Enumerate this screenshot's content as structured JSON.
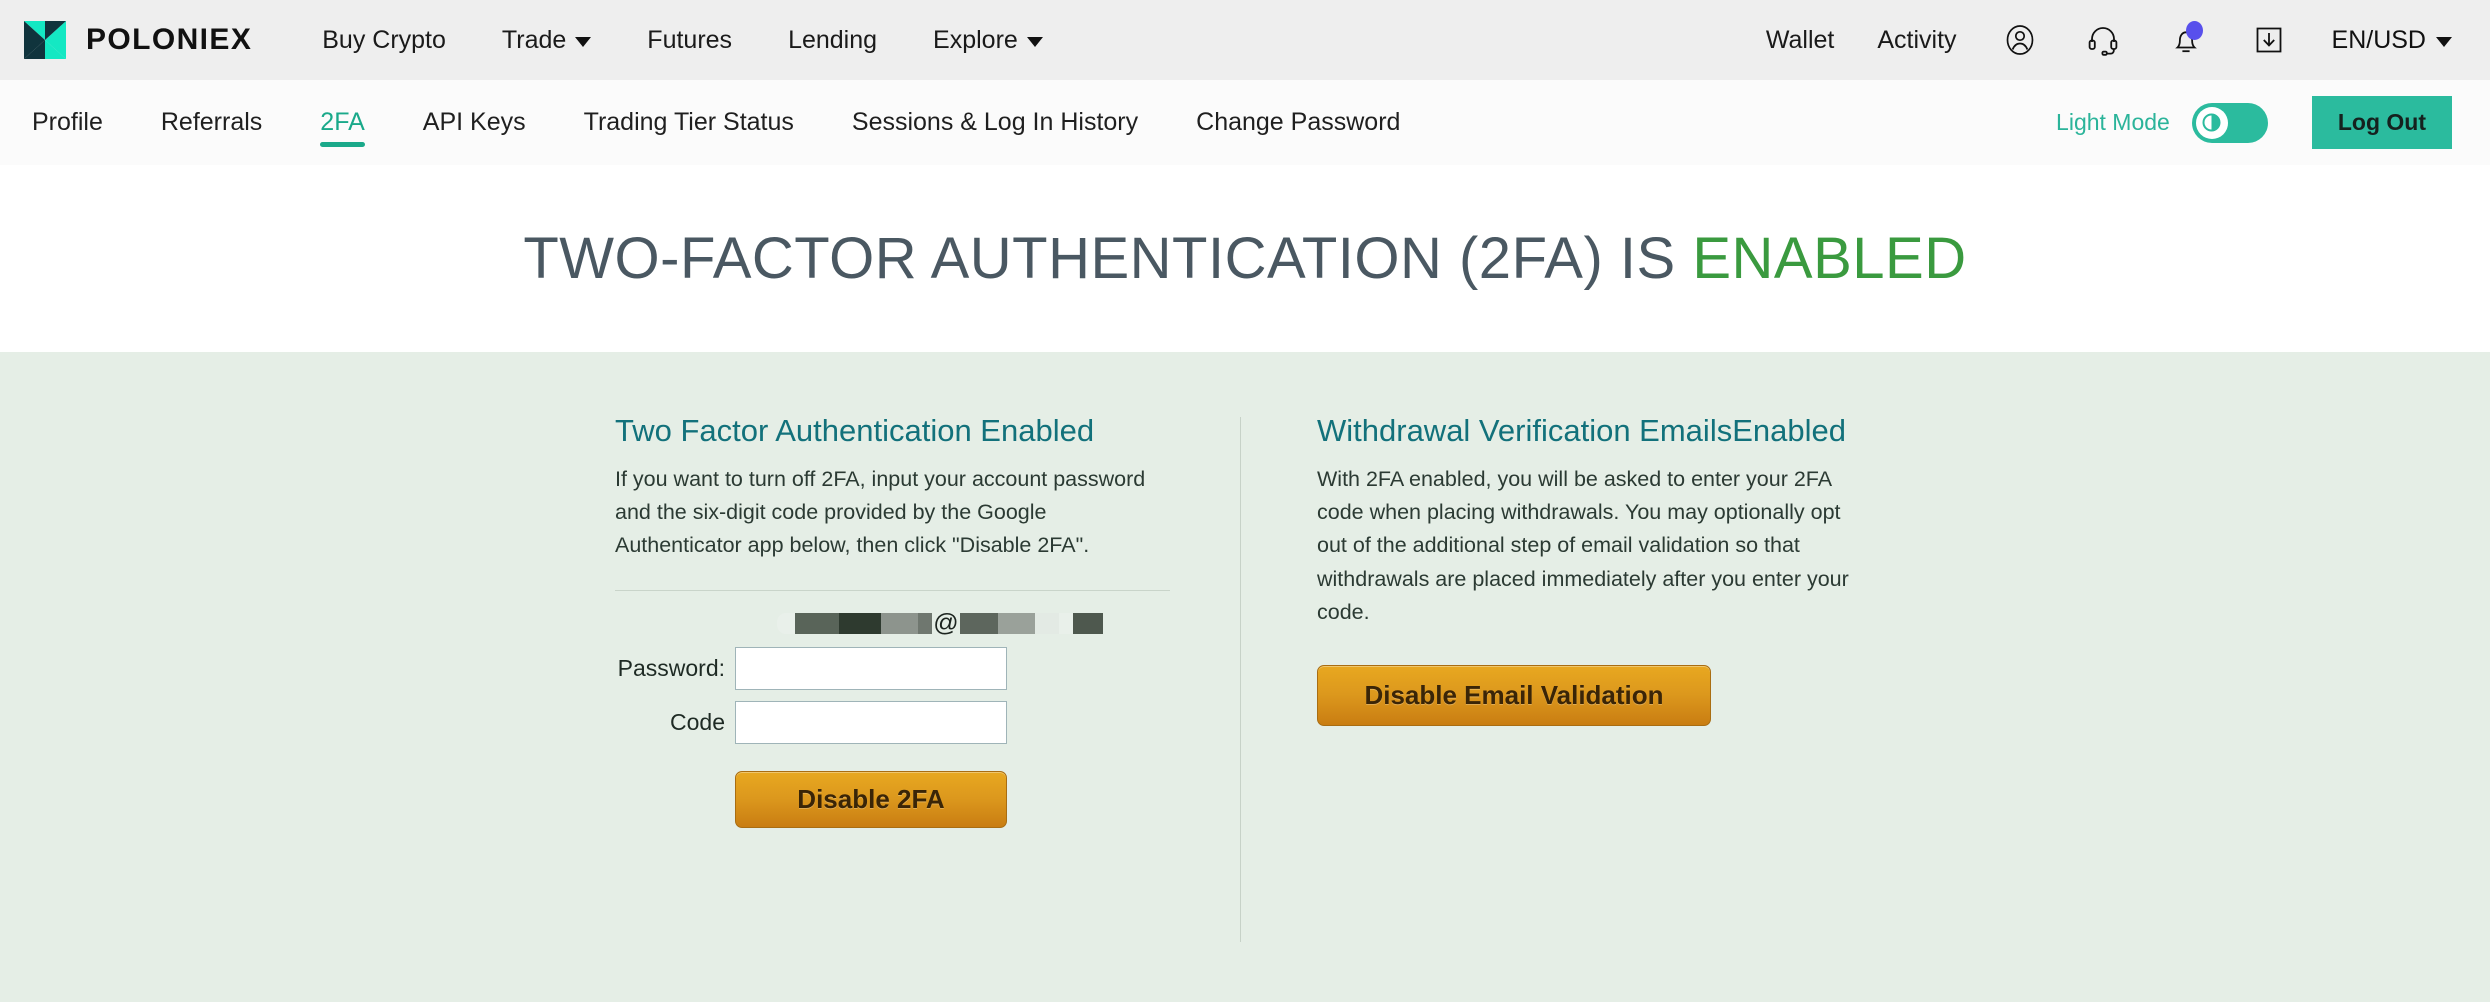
{
  "brand": {
    "name": "POLONIEX",
    "logo_icon": "poloniex-butterfly-logo",
    "colors": {
      "teal": "#19e0bb",
      "navy": "#10343d"
    }
  },
  "topnav": {
    "background": "#eeeeee",
    "links": [
      {
        "label": "Buy Crypto",
        "has_dropdown": false
      },
      {
        "label": "Trade",
        "has_dropdown": true
      },
      {
        "label": "Futures",
        "has_dropdown": false
      },
      {
        "label": "Lending",
        "has_dropdown": false
      },
      {
        "label": "Explore",
        "has_dropdown": true
      }
    ],
    "right_links": [
      {
        "label": "Wallet"
      },
      {
        "label": "Activity"
      }
    ],
    "icons": [
      {
        "name": "user-account-icon"
      },
      {
        "name": "headset-support-icon"
      },
      {
        "name": "notification-bell-icon",
        "badge": true,
        "badge_color": "#5850ec"
      },
      {
        "name": "download-inbox-icon"
      }
    ],
    "language": {
      "label": "EN/USD",
      "has_dropdown": true
    }
  },
  "subnav": {
    "background": "#fbfbfb",
    "tabs": [
      {
        "label": "Profile",
        "active": false
      },
      {
        "label": "Referrals",
        "active": false
      },
      {
        "label": "2FA",
        "active": true
      },
      {
        "label": "API Keys",
        "active": false
      },
      {
        "label": "Trading Tier Status",
        "active": false
      },
      {
        "label": "Sessions & Log In History",
        "active": false
      },
      {
        "label": "Change Password",
        "active": false
      }
    ],
    "active_color": "#1aa98a",
    "light_mode_label": "Light Mode",
    "light_mode_on": true,
    "logout_label": "Log Out",
    "logout_color": "#2bbb9e"
  },
  "hero": {
    "title_prefix": "TWO-FACTOR AUTHENTICATION (2FA) IS ",
    "title_status": "ENABLED",
    "status_color": "#3a9a3f",
    "text_color": "#4a5862"
  },
  "left_card": {
    "title": "Two Factor Authentication Enabled",
    "body": "If you want to turn off 2FA, input your account password and the six-digit code provided by the Google Authenticator app below, then click \"Disable 2FA\".",
    "email_masked": "███████@█████ ██",
    "password_label": "Password:",
    "password_value": "",
    "code_label": "Code",
    "code_value": "",
    "button_label": "Disable 2FA"
  },
  "right_card": {
    "title": "Withdrawal Verification EmailsEnabled",
    "body": "With 2FA enabled, you will be asked to enter your 2FA code when placing withdrawals. You may optionally opt out of the additional step of email validation so that withdrawals are placed immediately after you enter your code.",
    "button_label": "Disable Email Validation"
  },
  "theme": {
    "page_background": "#e5eee6",
    "hero_background": "#ffffff",
    "card_title_color": "#12717b",
    "orange_button": "#dc981d"
  }
}
